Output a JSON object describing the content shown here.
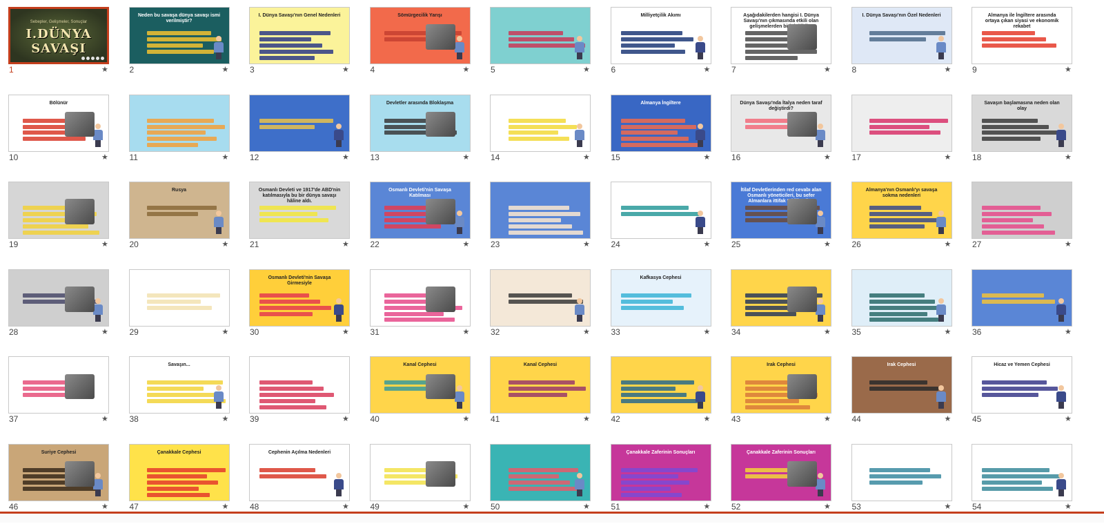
{
  "app": {
    "view": "slide-sorter",
    "selected_slide": 1
  },
  "slide_one": {
    "title": "I.DÜNYA SAVAŞI",
    "subtitle": "Sebepler, Gelişmeler, Sonuçlar"
  },
  "slide_texts": {
    "2": "Neden bu savaşa dünya savaşı ismi verilmiştir?",
    "3": "I. Dünya Savaşı'nın Genel Nedenleri",
    "4": "Sömürgecilik Yarışı",
    "6": "Milliyetçilik Akımı",
    "7": "Aşağıdakilerden hangisi I. Dünya Savaşı'nın çıkmasında etkili olan gelişmelerden biri değildir?",
    "8": "I. Dünya Savaşı'nın Özel Nedenleri",
    "9": "Almanya ile İngiltere arasında ortaya çıkan siyasi ve ekonomik rekabet",
    "10": "Bölünür",
    "13": "Devletler arasında Bloklaşma",
    "15": "Almanya   İngiltere",
    "16": "Dünya Savaşı'nda İtalya neden taraf değiştirdi?",
    "18": "Savaşın başlamasına neden olan olay",
    "20": "Rusya",
    "21": "Osmanlı Devleti ve 1917'de ABD'nin katılmasıyla bu bir dünya savaşı hâline aldı.",
    "22": "Osmanlı Devleti'nin Savaşa Katılması",
    "25": "İtilaf Devletlerinden red cevabı alan Osmanlı yöneticileri, bu sefer Almanlara ittifak teklif ettiler.",
    "26": "Almanya'nın Osmanlı'yı savaşa sokma nedenleri",
    "30": "Osmanlı Devleti'nin Savaşa Girmesiyle",
    "33": "Kafkasya Cephesi",
    "38": "Savaşın...",
    "40": "Kanal Cephesi",
    "41": "Kanal Cephesi",
    "43": "Irak Cephesi",
    "44": "Irak Cephesi",
    "45": "Hicaz ve Yemen Cephesi",
    "46": "Suriye Cephesi",
    "47": "Çanakkale Cephesi",
    "48": "Cephenin Açılma Nedenleri",
    "51": "Çanakkale Zaferinin Sonuçları",
    "52": "Çanakkale Zaferinin Sonuçları"
  },
  "slides": [
    {
      "n": "1",
      "c": "#3f4a2a",
      "a": "#6b7a45"
    },
    {
      "n": "2",
      "c": "#1b5e60",
      "a": "#f2c230"
    },
    {
      "n": "3",
      "c": "#fbf39a",
      "a": "#2d3a86"
    },
    {
      "n": "4",
      "c": "#f26a4b",
      "a": "#c64030"
    },
    {
      "n": "5",
      "c": "#7fd0d0",
      "a": "#c93a58"
    },
    {
      "n": "6",
      "c": "#ffffff",
      "a": "#1e3a78"
    },
    {
      "n": "7",
      "c": "#ffffff",
      "a": "#4a4a4a"
    },
    {
      "n": "8",
      "c": "#dfe8f6",
      "a": "#4d6a8a"
    },
    {
      "n": "9",
      "c": "#ffffff",
      "a": "#e53b2a"
    },
    {
      "n": "10",
      "c": "#ffffff",
      "a": "#d93b2a"
    },
    {
      "n": "11",
      "c": "#a7dcef",
      "a": "#f2a03a"
    },
    {
      "n": "12",
      "c": "#3e6fc9",
      "a": "#e9c24c"
    },
    {
      "n": "13",
      "c": "#a8ddee",
      "a": "#3a3a3a"
    },
    {
      "n": "14",
      "c": "#ffffff",
      "a": "#f2d93a"
    },
    {
      "n": "15",
      "c": "#3967c4",
      "a": "#f06b4e"
    },
    {
      "n": "16",
      "c": "#e8e8e8",
      "a": "#f26a7a"
    },
    {
      "n": "17",
      "c": "#eeeeee",
      "a": "#d8336a"
    },
    {
      "n": "18",
      "c": "#d9d9d9",
      "a": "#3a3a3a"
    },
    {
      "n": "19",
      "c": "#d6d6d6",
      "a": "#f2d13a"
    },
    {
      "n": "20",
      "c": "#cfb58f",
      "a": "#8a6a3a"
    },
    {
      "n": "21",
      "c": "#d9d9d9",
      "a": "#f2e63a"
    },
    {
      "n": "22",
      "c": "#5a86d6",
      "a": "#e53b4f"
    },
    {
      "n": "23",
      "c": "#5a86d6",
      "a": "#fbe8d0"
    },
    {
      "n": "24",
      "c": "#ffffff",
      "a": "#2a9a9a"
    },
    {
      "n": "25",
      "c": "#4a7ad6",
      "a": "#6a4a3a"
    },
    {
      "n": "26",
      "c": "#ffd54a",
      "a": "#3a4a8a"
    },
    {
      "n": "27",
      "c": "#cfcfcf",
      "a": "#e64a8a"
    },
    {
      "n": "28",
      "c": "#cfcfcf",
      "a": "#4a4a6a"
    },
    {
      "n": "29",
      "c": "#ffffff",
      "a": "#f2e2b0"
    },
    {
      "n": "30",
      "c": "#ffcf3a",
      "a": "#e53b4f"
    },
    {
      "n": "31",
      "c": "#ffffff",
      "a": "#e64a8a"
    },
    {
      "n": "32",
      "c": "#f4e8d8",
      "a": "#3a3a3a"
    },
    {
      "n": "33",
      "c": "#e6f2fb",
      "a": "#3ab4d6"
    },
    {
      "n": "34",
      "c": "#ffd54a",
      "a": "#2a3a5a"
    },
    {
      "n": "35",
      "c": "#dfeef8",
      "a": "#2a6a6a"
    },
    {
      "n": "36",
      "c": "#5a86d6",
      "a": "#f2c23a"
    },
    {
      "n": "37",
      "c": "#ffffff",
      "a": "#e6507a"
    },
    {
      "n": "38",
      "c": "#ffffff",
      "a": "#f2d43a"
    },
    {
      "n": "39",
      "c": "#ffffff",
      "a": "#d93b5a"
    },
    {
      "n": "40",
      "c": "#ffd54a",
      "a": "#3a9a9a"
    },
    {
      "n": "41",
      "c": "#ffd54a",
      "a": "#9a3a6a"
    },
    {
      "n": "42",
      "c": "#ffd54a",
      "a": "#2a6a8a"
    },
    {
      "n": "43",
      "c": "#ffd54a",
      "a": "#d97a3a"
    },
    {
      "n": "44",
      "c": "#9a6a4a",
      "a": "#2a2a2a"
    },
    {
      "n": "45",
      "c": "#ffffff",
      "a": "#3a3a8a"
    },
    {
      "n": "46",
      "c": "#c9a678",
      "a": "#3a2a1a"
    },
    {
      "n": "47",
      "c": "#ffe24a",
      "a": "#e53b2a"
    },
    {
      "n": "48",
      "c": "#ffffff",
      "a": "#d93b2a"
    },
    {
      "n": "49",
      "c": "#ffffff",
      "a": "#f2e24a"
    },
    {
      "n": "50",
      "c": "#3ab4b4",
      "a": "#e65a6a"
    },
    {
      "n": "51",
      "c": "#c6379a",
      "a": "#7a4ad6"
    },
    {
      "n": "52",
      "c": "#c6379a",
      "a": "#f2d43a"
    },
    {
      "n": "53",
      "c": "#ffffff",
      "a": "#3a8aa0"
    },
    {
      "n": "54",
      "c": "#ffffff",
      "a": "#3a8a9a"
    }
  ],
  "star_glyph": "★",
  "colors": {
    "selection": "#c43e1c",
    "thumb_border": "#c8c8c8"
  }
}
